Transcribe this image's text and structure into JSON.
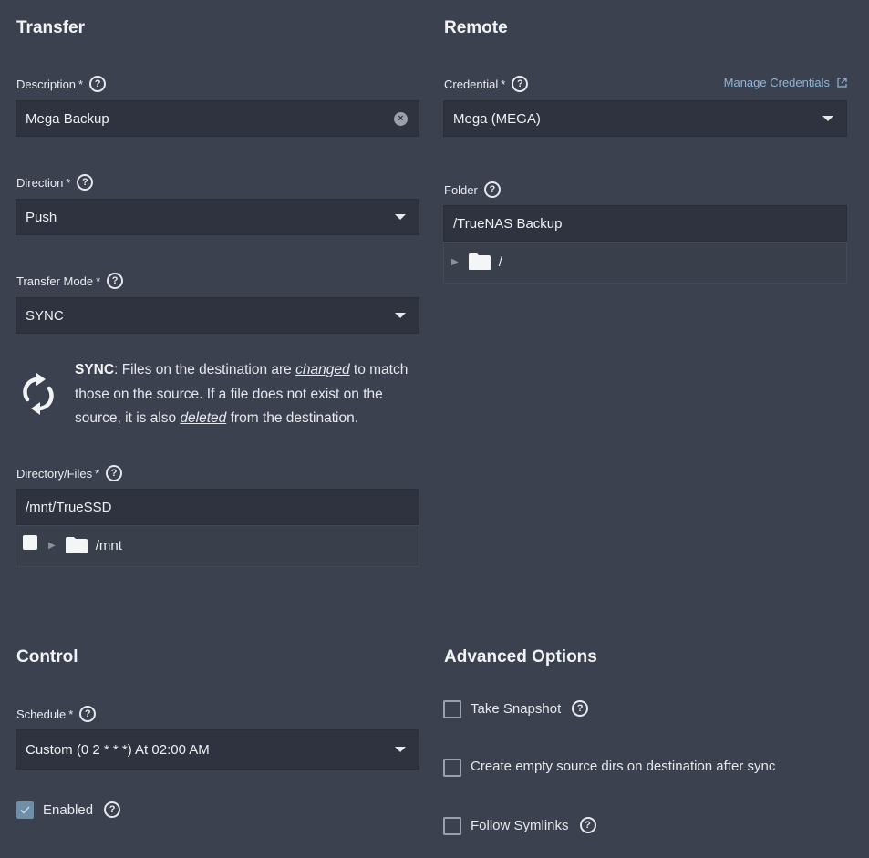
{
  "transfer": {
    "title": "Transfer",
    "description": {
      "label": "Description",
      "req": "*",
      "value": "Mega Backup"
    },
    "direction": {
      "label": "Direction",
      "req": "*",
      "value": "Push"
    },
    "transfer_mode": {
      "label": "Transfer Mode",
      "req": "*",
      "value": "SYNC"
    },
    "sync_info": {
      "bold": "SYNC",
      "part1": ": Files on the destination are ",
      "changed": "changed",
      "part2": " to match those on the source. If a file does not exist on the source, it is also ",
      "deleted": "deleted",
      "part3": " from the destination."
    },
    "directory": {
      "label": "Directory/Files",
      "req": "*",
      "value": "/mnt/TrueSSD",
      "tree_node": "/mnt"
    }
  },
  "remote": {
    "title": "Remote",
    "credential": {
      "label": "Credential",
      "req": "*",
      "value": "Mega (MEGA)",
      "manage_link": "Manage Credentials"
    },
    "folder": {
      "label": "Folder",
      "value": "/TrueNAS Backup",
      "tree_node": "/"
    }
  },
  "control": {
    "title": "Control",
    "schedule": {
      "label": "Schedule",
      "req": "*",
      "value": "Custom (0 2 * * *) At 02:00 AM"
    },
    "enabled": {
      "label": "Enabled",
      "checked": true
    }
  },
  "advanced": {
    "title": "Advanced Options",
    "take_snapshot": "Take Snapshot",
    "create_empty_dirs": "Create empty source dirs on destination after sync",
    "follow_symlinks": "Follow Symlinks"
  },
  "help_glyph": "?",
  "clear_glyph": "×",
  "colors": {
    "background": "#3c4150",
    "field": "#2f333f",
    "link": "#8fb6d6",
    "checked_box": "#6f8ea8"
  }
}
